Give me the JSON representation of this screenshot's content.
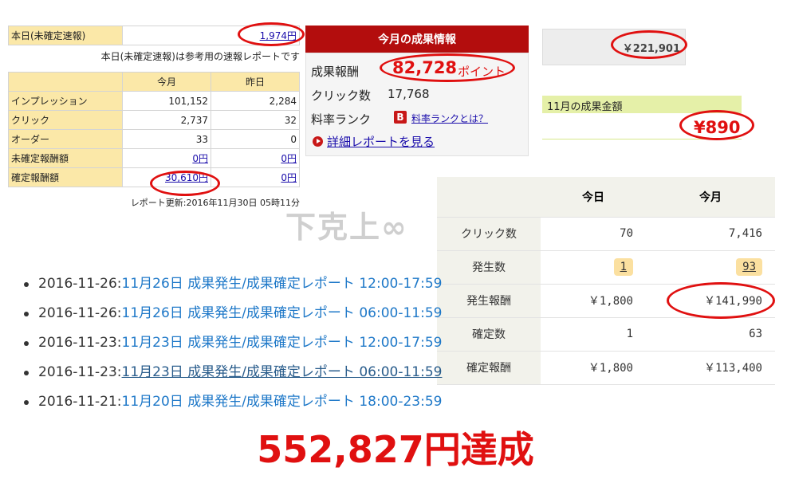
{
  "panel_a": {
    "today_label": "本日(未確定速報)",
    "today_value": "1,974円",
    "note": "本日(未確定速報)は参考用の速報レポートです",
    "headers": [
      "",
      "今月",
      "昨日"
    ],
    "rows": [
      {
        "label": "インプレッション",
        "this_month": "101,152",
        "yesterday": "2,284"
      },
      {
        "label": "クリック",
        "this_month": "2,737",
        "yesterday": "32"
      },
      {
        "label": "オーダー",
        "this_month": "33",
        "yesterday": "0"
      },
      {
        "label": "未確定報酬額",
        "this_month": "0円",
        "yesterday": "0円"
      },
      {
        "label": "確定報酬額",
        "this_month": "30,610円",
        "yesterday": "0円"
      }
    ],
    "updated": "レポート更新:2016年11月30日 05時11分"
  },
  "panel_b": {
    "title": "今月の成果情報",
    "reward_label": "成果報酬",
    "reward_value": "82,728",
    "reward_unit": "ポイント",
    "click_label": "クリック数",
    "click_value": "17,768",
    "rank_label": "料率ランク",
    "rank_badge": "B",
    "rank_link": "料率ランクとは？",
    "detail_link": "詳細レポートを見る"
  },
  "panel_c": {
    "amount": "￥221,901",
    "month_label": "11月の成果金額",
    "month_value": "¥890"
  },
  "watermark": "下克上∞",
  "panel_d": {
    "headers": [
      "",
      "今日",
      "今月"
    ],
    "rows": [
      {
        "label": "クリック数",
        "today": "70",
        "month": "7,416"
      },
      {
        "label": "発生数",
        "today": "1",
        "month": "93"
      },
      {
        "label": "発生報酬",
        "today": "￥1,800",
        "month": "￥141,990"
      },
      {
        "label": "確定数",
        "today": "1",
        "month": "63"
      },
      {
        "label": "確定報酬",
        "today": "￥1,800",
        "month": "￥113,400"
      }
    ]
  },
  "report_list": {
    "items": [
      {
        "date": "2016-11-26:",
        "title": "11月26日 成果発生/成果確定レポート 12:00-17:59"
      },
      {
        "date": "2016-11-26:",
        "title": "11月26日 成果発生/成果確定レポート 06:00-11:59"
      },
      {
        "date": "2016-11-23:",
        "title": "11月23日 成果発生/成果確定レポート 12:00-17:59"
      },
      {
        "date": "2016-11-23:",
        "title": "11月23日 成果発生/成果確定レポート 06:00-11:59"
      },
      {
        "date": "2016-11-21:",
        "title": "11月20日 成果発生/成果確定レポート 18:00-23:59"
      }
    ]
  },
  "caption": "552,827円達成",
  "colors": {
    "accent_red": "#e01010",
    "header_red": "#b30d0d",
    "link_blue": "#1e78c8"
  }
}
